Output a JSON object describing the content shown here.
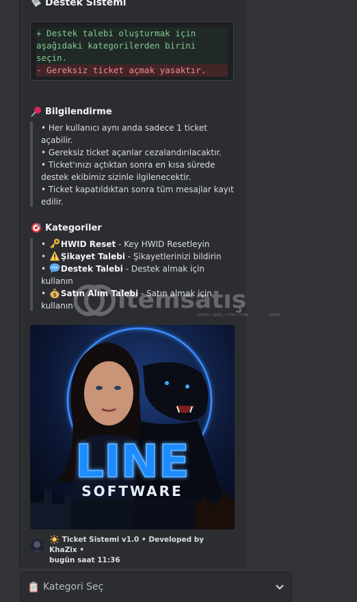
{
  "title": "Destek Sistemi",
  "code": {
    "add_line1": "+ Destek talebi oluşturmak için",
    "add_line2": "aşağıdaki kategorilerden birini",
    "add_line3": "seçin.",
    "rem_line": "- Gereksiz ticket açmak yasaktır."
  },
  "info": {
    "heading": "Bilgilendirme",
    "lines": [
      "• Her kullanıcı aynı anda sadece 1 ticket açabilir.",
      "• Gereksiz ticket açanlar cezalandırılacaktır.",
      "• Ticket'ınızı açtıktan sonra en kısa sürede destek ekibimiz sizinle ilgilenecektir.",
      "• Ticket kapatıldıktan sonra tüm mesajlar kayıt edilir."
    ]
  },
  "categories": {
    "heading": "Kategoriler",
    "items": [
      {
        "name": "HWID Reset",
        "desc": " - Key HWID Resetleyin"
      },
      {
        "name": "Şikayet Talebi",
        "desc": " - Şikayetlerinizi bildirin"
      },
      {
        "name": "Destek Talebi",
        "desc": " - Destek almak için kullanın"
      },
      {
        "name": "Satın Alım Talebi",
        "desc": " - Satın almak için kullanın"
      }
    ]
  },
  "banner": {
    "line1": "LINE",
    "line2": "SOFTWARE"
  },
  "footer": {
    "text": "Ticket Sistemi v1.0 • Developed by KhaZix •",
    "time": "bugün saat 11:36"
  },
  "select": {
    "placeholder": "Kategori Seç"
  },
  "watermark": {
    "brand": "itemsatış",
    "sub": "OYUNA • ŞEKİL • İTEM • E-PİN",
    "suffix": ".com"
  },
  "colors": {
    "background": "#313338",
    "embed": "#2b2d31",
    "diff_add": "#81c995",
    "diff_remove": "#f38b8d",
    "neon": "#1e8bff"
  },
  "icons": {
    "title": "ticket-icon",
    "info": "pushpin-icon",
    "categories": "target-icon",
    "hwid": "key-icon",
    "complaint": "warning-icon",
    "support": "speech-bubble-icon",
    "purchase": "money-bag-icon",
    "footer": "sun-icon",
    "select": "clipboard-icon",
    "dropdown": "chevron-down-icon"
  }
}
